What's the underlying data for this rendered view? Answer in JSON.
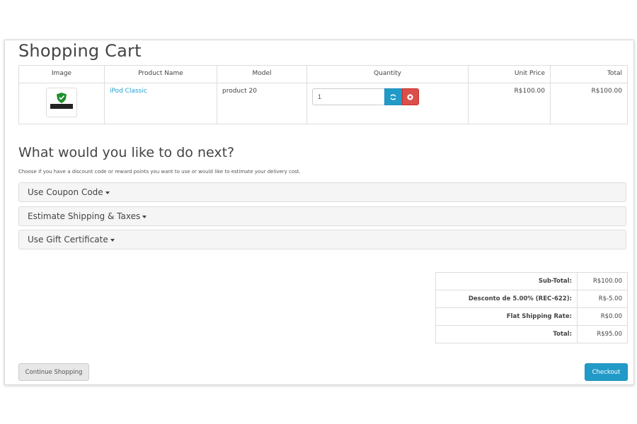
{
  "page": {
    "title": "Shopping Cart"
  },
  "cart": {
    "headers": [
      "Image",
      "Product Name",
      "Model",
      "Quantity",
      "Unit Price",
      "Total"
    ],
    "items": [
      {
        "product_name": "iPod Classic",
        "model": "product 20",
        "quantity": "1",
        "unit_price": "R$100.00",
        "total": "R$100.00",
        "thumb_icon": "protected-site-badge"
      }
    ],
    "update_icon": "refresh-icon",
    "remove_icon": "remove-icon"
  },
  "next": {
    "title": "What would you like to do next?",
    "description": "Choose if you have a discount code or reward points you want to use or would like to estimate your delivery cost.",
    "panels": [
      "Use Coupon Code",
      "Estimate Shipping & Taxes",
      "Use Gift Certificate"
    ]
  },
  "totals": [
    {
      "label": "Sub-Total:",
      "value": "R$100.00"
    },
    {
      "label": "Desconto de 5.00% (REC-622):",
      "value": "R$-5.00"
    },
    {
      "label": "Flat Shipping Rate:",
      "value": "R$0.00"
    },
    {
      "label": "Total:",
      "value": "R$95.00"
    }
  ],
  "buttons": {
    "continue": "Continue Shopping",
    "checkout": "Checkout"
  },
  "colors": {
    "link": "#23a1d1",
    "primary": "#229ac8",
    "danger": "#da4f49"
  }
}
